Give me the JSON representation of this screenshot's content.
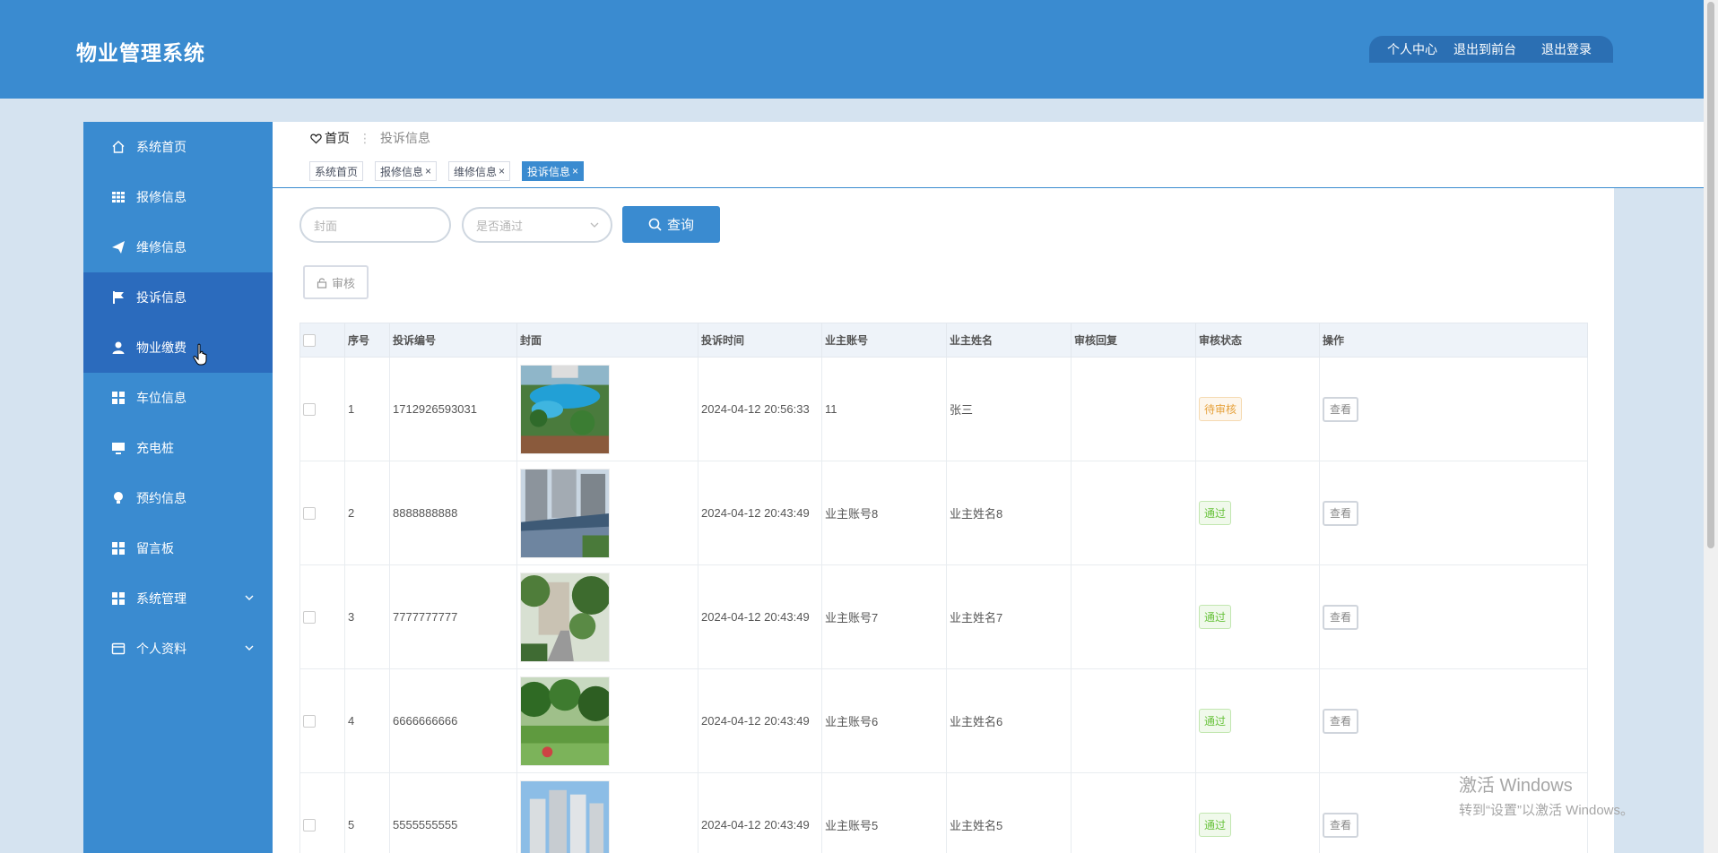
{
  "app": {
    "title": "物业管理系统"
  },
  "header": {
    "links": [
      "个人中心",
      "退出到前台",
      "退出登录"
    ]
  },
  "sidebar": {
    "items": [
      {
        "label": "系统首页",
        "icon": "home-icon"
      },
      {
        "label": "报修信息",
        "icon": "grid-icon"
      },
      {
        "label": "维修信息",
        "icon": "send-icon"
      },
      {
        "label": "投诉信息",
        "icon": "flag-icon"
      },
      {
        "label": "物业缴费",
        "icon": "user-icon"
      },
      {
        "label": "车位信息",
        "icon": "apps-icon"
      },
      {
        "label": "充电桩",
        "icon": "monitor-icon"
      },
      {
        "label": "预约信息",
        "icon": "bulb-icon"
      },
      {
        "label": "留言板",
        "icon": "apps-icon"
      },
      {
        "label": "系统管理",
        "icon": "apps-icon"
      },
      {
        "label": "个人资料",
        "icon": "card-icon"
      }
    ]
  },
  "breadcrumb": {
    "home": "首页",
    "current": "投诉信息"
  },
  "tags": [
    {
      "label": "系统首页"
    },
    {
      "label": "报修信息"
    },
    {
      "label": "维修信息"
    },
    {
      "label": "投诉信息"
    }
  ],
  "search": {
    "cover_placeholder": "封面",
    "passed_placeholder": "是否通过",
    "button": "查询"
  },
  "audit_button": "审核",
  "table": {
    "headers": [
      "序号",
      "投诉编号",
      "封面",
      "投诉时间",
      "业主账号",
      "业主姓名",
      "审核回复",
      "审核状态",
      "操作"
    ],
    "rows": [
      {
        "index": "1",
        "code": "1712926593031",
        "time": "2024-04-12 20:56:33",
        "account": "11",
        "name": "张三",
        "reply": "",
        "status": "待审核",
        "action": "查看"
      },
      {
        "index": "2",
        "code": "8888888888",
        "time": "2024-04-12 20:43:49",
        "account": "业主账号8",
        "name": "业主姓名8",
        "reply": "",
        "status": "通过",
        "action": "查看"
      },
      {
        "index": "3",
        "code": "7777777777",
        "time": "2024-04-12 20:43:49",
        "account": "业主账号7",
        "name": "业主姓名7",
        "reply": "",
        "status": "通过",
        "action": "查看"
      },
      {
        "index": "4",
        "code": "6666666666",
        "time": "2024-04-12 20:43:49",
        "account": "业主账号6",
        "name": "业主姓名6",
        "reply": "",
        "status": "通过",
        "action": "查看"
      },
      {
        "index": "5",
        "code": "5555555555",
        "time": "2024-04-12 20:43:49",
        "account": "业主账号5",
        "name": "业主姓名5",
        "reply": "",
        "status": "通过",
        "action": "查看"
      }
    ]
  },
  "watermark": {
    "line1": "激活 Windows",
    "line2": "转到“设置”以激活 Windows。"
  },
  "colors": {
    "primary": "#3a8bd0",
    "active": "#2b6bbd",
    "page_bg": "#d5e3f0"
  }
}
